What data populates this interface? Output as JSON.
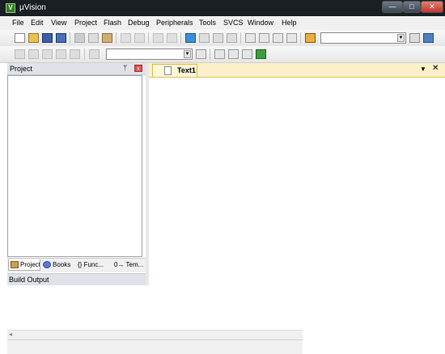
{
  "window": {
    "title": "µVision",
    "app_icon_glyph": "V"
  },
  "title_controls": {
    "minimize": "—",
    "maximize": "□",
    "close": "✕"
  },
  "menu": [
    "File",
    "Edit",
    "View",
    "Project",
    "Flash",
    "Debug",
    "Peripherals",
    "Tools",
    "SVCS",
    "Window",
    "Help"
  ],
  "toolbar1": {
    "icons": [
      "new-file-icon",
      "open-folder-icon",
      "save-icon",
      "save-all-icon",
      "cut-icon",
      "copy-icon",
      "paste-icon",
      "undo-icon",
      "redo-icon",
      "nav-back-icon",
      "nav-forward-icon",
      "bookmark-icon",
      "prev-bookmark-icon",
      "next-bookmark-icon",
      "clear-bookmarks-icon",
      "indent-icon",
      "unindent-icon",
      "comment-icon",
      "uncomment-icon",
      "find-in-files-icon"
    ],
    "find_value": "",
    "after_combo_icons": [
      "find-icon",
      "debug-session-icon"
    ]
  },
  "toolbar2": {
    "icons": [
      "translate-icon",
      "build-icon",
      "rebuild-icon",
      "batch-build-icon",
      "stop-build-icon",
      "download-icon"
    ],
    "target_value": "",
    "after_combo_icons": [
      "target-options-icon",
      "file-extensions-icon",
      "manage-run-time-icon",
      "pack-installer-icon"
    ]
  },
  "project_pane": {
    "title": "Project",
    "pin": "ᛘ",
    "close": "x",
    "tabs": [
      {
        "label": "Project",
        "icon": "project-tab-icon"
      },
      {
        "label": "Books",
        "icon": "books-tab-icon"
      },
      {
        "label": "{} Func...",
        "icon": "functions-tab-icon"
      },
      {
        "label": "0→ Tem...",
        "icon": "templates-tab-icon"
      }
    ]
  },
  "editor": {
    "tab_label": "Text1",
    "dropdown": "▼",
    "close": "✕"
  },
  "build_output": {
    "title": "Build Output",
    "scroll_left": "◂"
  },
  "colors": {
    "titlebar": "#1a1f24",
    "editor_tab_accent": "#fbf0c8",
    "close_button": "#c0392b"
  }
}
